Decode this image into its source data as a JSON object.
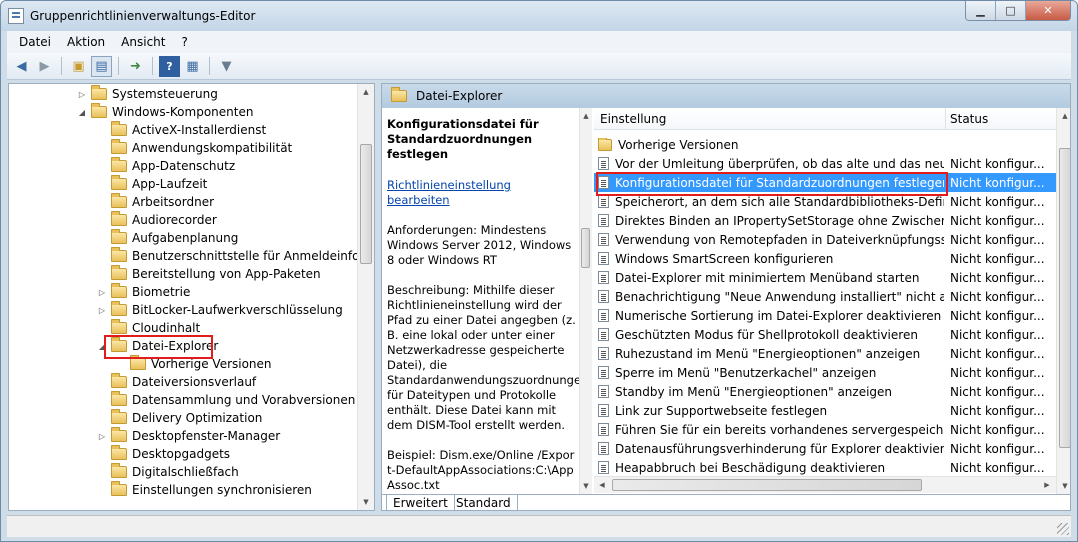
{
  "window": {
    "title": "Gruppenrichtlinienverwaltungs-Editor"
  },
  "menubar": {
    "items": [
      "Datei",
      "Aktion",
      "Ansicht",
      "?"
    ]
  },
  "toolbar": {
    "icons": [
      "back-icon",
      "forward-icon",
      "up-folder-icon",
      "show-hide-tree-icon",
      "export-list-icon",
      "help-icon",
      "properties-view-icon",
      "filter-icon"
    ]
  },
  "tree": {
    "items": [
      {
        "label": "Systemsteuerung",
        "expander": "▷"
      },
      {
        "label": "Windows-Komponenten",
        "expander": "◢"
      },
      {
        "label": "ActiveX-Installerdienst",
        "expander": ""
      },
      {
        "label": "Anwendungskompatibilität",
        "expander": ""
      },
      {
        "label": "App-Datenschutz",
        "expander": ""
      },
      {
        "label": "App-Laufzeit",
        "expander": ""
      },
      {
        "label": "Arbeitsordner",
        "expander": ""
      },
      {
        "label": "Audiorecorder",
        "expander": ""
      },
      {
        "label": "Aufgabenplanung",
        "expander": ""
      },
      {
        "label": "Benutzerschnittstelle für Anmeldeinformati",
        "expander": ""
      },
      {
        "label": "Bereitstellung von App-Paketen",
        "expander": ""
      },
      {
        "label": "Biometrie",
        "expander": "▷"
      },
      {
        "label": "BitLocker-Laufwerkverschlüsselung",
        "expander": "▷"
      },
      {
        "label": "Cloudinhalt",
        "expander": ""
      },
      {
        "label": "Datei-Explorer",
        "expander": "◢"
      },
      {
        "label": "Vorherige Versionen",
        "expander": ""
      },
      {
        "label": "Dateiversionsverlauf",
        "expander": ""
      },
      {
        "label": "Datensammlung und Vorabversionen",
        "expander": ""
      },
      {
        "label": "Delivery Optimization",
        "expander": ""
      },
      {
        "label": "Desktopfenster-Manager",
        "expander": "▷"
      },
      {
        "label": "Desktopgadgets",
        "expander": ""
      },
      {
        "label": "Digitalschließfach",
        "expander": ""
      },
      {
        "label": "Einstellungen synchronisieren",
        "expander": ""
      }
    ]
  },
  "panel": {
    "header": "Datei-Explorer"
  },
  "description": {
    "title": "Konfigurationsdatei für Standardzuordnungen festlegen",
    "link": "Richtlinieneinstellung bearbeiten",
    "requirements": "Anforderungen: Mindestens Windows Server 2012, Windows 8 oder Windows RT",
    "description": "Beschreibung: Mithilfe dieser Richtlinieneinstellung wird der Pfad zu einer Datei angegben (z. B. eine lokal oder unter einer Netzwerkadresse gespeicherte Datei), die Standardanwendungszuordnungen für Dateitypen und Protokolle enthält. Diese Datei kann mit dem DISM-Tool erstellt werden.",
    "example": "Beispiel: Dism.exe/Online /Export-DefaultAppAssociations:C:\\AppAssoc.txt"
  },
  "list": {
    "columns": {
      "name": "Einstellung",
      "status": "Status"
    },
    "rows": [
      {
        "name": "Vorherige Versionen",
        "status": "",
        "type": "folder"
      },
      {
        "name": "Vor der Umleitung überprüfen, ob das alte und das neue Zie...",
        "status": "Nicht konfigur...",
        "type": "doc"
      },
      {
        "name": "Konfigurationsdatei für Standardzuordnungen festlegen",
        "status": "Nicht konfigur...",
        "type": "doc"
      },
      {
        "name": "Speicherort, an dem sich alle Standardbibliotheks-Definition...",
        "status": "Nicht konfigur...",
        "type": "doc"
      },
      {
        "name": "Direktes Binden an IPropertySetStorage ohne Zwischenschic...",
        "status": "Nicht konfigur...",
        "type": "doc"
      },
      {
        "name": "Verwendung von Remotepfaden in Dateiverknüpfungssymb...",
        "status": "Nicht konfigur...",
        "type": "doc"
      },
      {
        "name": "Windows SmartScreen konfigurieren",
        "status": "Nicht konfigur...",
        "type": "doc"
      },
      {
        "name": "Datei-Explorer mit minimiertem Menüband starten",
        "status": "Nicht konfigur...",
        "type": "doc"
      },
      {
        "name": "Benachrichtigung \"Neue Anwendung installiert\" nicht anzei...",
        "status": "Nicht konfigur...",
        "type": "doc"
      },
      {
        "name": "Numerische Sortierung im Datei-Explorer deaktivieren",
        "status": "Nicht konfigur...",
        "type": "doc"
      },
      {
        "name": "Geschützten Modus für Shellprotokoll deaktivieren",
        "status": "Nicht konfigur...",
        "type": "doc"
      },
      {
        "name": "Ruhezustand im Menü \"Energieoptionen\" anzeigen",
        "status": "Nicht konfigur...",
        "type": "doc"
      },
      {
        "name": "Sperre im Menü \"Benutzerkachel\" anzeigen",
        "status": "Nicht konfigur...",
        "type": "doc"
      },
      {
        "name": "Standby im Menü \"Energieoptionen\" anzeigen",
        "status": "Nicht konfigur...",
        "type": "doc"
      },
      {
        "name": "Link zur Supportwebseite festlegen",
        "status": "Nicht konfigur...",
        "type": "doc"
      },
      {
        "name": "Führen Sie für ein bereits vorhandenes servergespeichertes B...",
        "status": "Nicht konfigur...",
        "type": "doc"
      },
      {
        "name": "Datenausführungsverhinderung für Explorer deaktivieren",
        "status": "Nicht konfigur...",
        "type": "doc"
      },
      {
        "name": "Heapabbruch bei Beschädigung deaktivieren",
        "status": "Nicht konfigur...",
        "type": "doc"
      }
    ]
  },
  "tabs": [
    "Erweitert",
    "Standard"
  ],
  "colors": {
    "selection": "#3399ff",
    "highlight_box": "#e21b1b",
    "header": "#c8daea"
  }
}
